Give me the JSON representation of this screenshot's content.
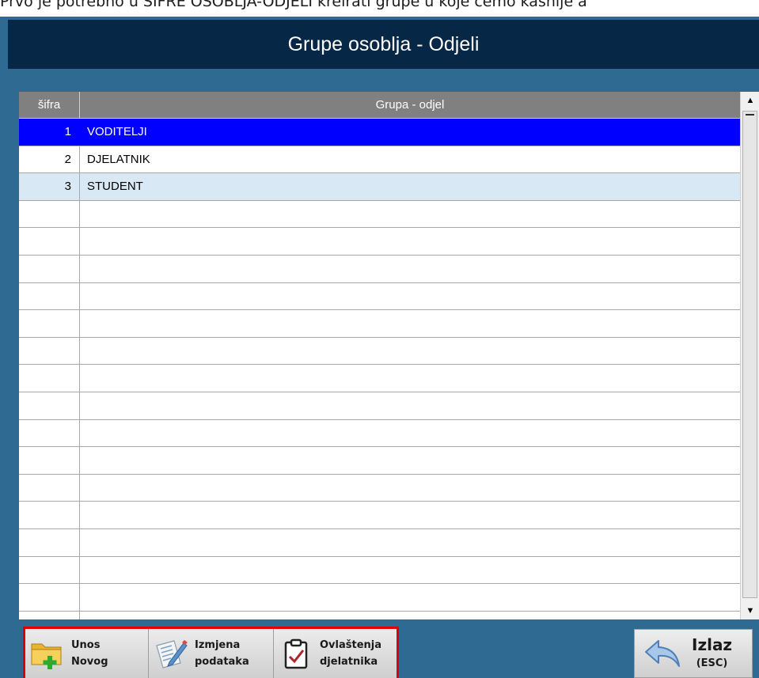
{
  "page_caption": "Prvo je potrebno u ŠIFRE OSOBLJA-ODJELI kreirati grupe u koje ćemo kasnije a",
  "window": {
    "title": "Grupe osoblja - Odjeli"
  },
  "grid": {
    "columns": [
      "šifra",
      "Grupa - odjel"
    ],
    "rows": [
      {
        "code": "1",
        "name": "VODITELJI",
        "state": "selected"
      },
      {
        "code": "2",
        "name": "DJELATNIK",
        "state": "normal"
      },
      {
        "code": "3",
        "name": "STUDENT",
        "state": "alternate"
      },
      {
        "code": "",
        "name": ""
      },
      {
        "code": "",
        "name": ""
      },
      {
        "code": "",
        "name": ""
      },
      {
        "code": "",
        "name": ""
      },
      {
        "code": "",
        "name": ""
      },
      {
        "code": "",
        "name": ""
      },
      {
        "code": "",
        "name": ""
      },
      {
        "code": "",
        "name": ""
      },
      {
        "code": "",
        "name": ""
      },
      {
        "code": "",
        "name": ""
      },
      {
        "code": "",
        "name": ""
      },
      {
        "code": "",
        "name": ""
      },
      {
        "code": "",
        "name": ""
      },
      {
        "code": "",
        "name": ""
      },
      {
        "code": "",
        "name": ""
      },
      {
        "code": "",
        "name": ""
      }
    ]
  },
  "toolbar": {
    "new": {
      "line1": "Unos",
      "line2": "Novog",
      "icon": "folder-plus-icon"
    },
    "edit": {
      "line1": "Izmjena",
      "line2": "podataka",
      "icon": "edit-document-icon"
    },
    "auth": {
      "line1": "Ovlaštenja",
      "line2": "djelatnika",
      "icon": "clipboard-check-icon"
    },
    "exit": {
      "title": "Izlaz",
      "key": "(ESC)",
      "icon": "back-arrow-icon"
    }
  },
  "colors": {
    "window_bg": "#2e6a92",
    "title_bar": "#062846",
    "selected_row": "#0000ff",
    "alternate_row": "#d9e8f5",
    "header_bg": "#808080",
    "highlight_border": "#e00000"
  }
}
